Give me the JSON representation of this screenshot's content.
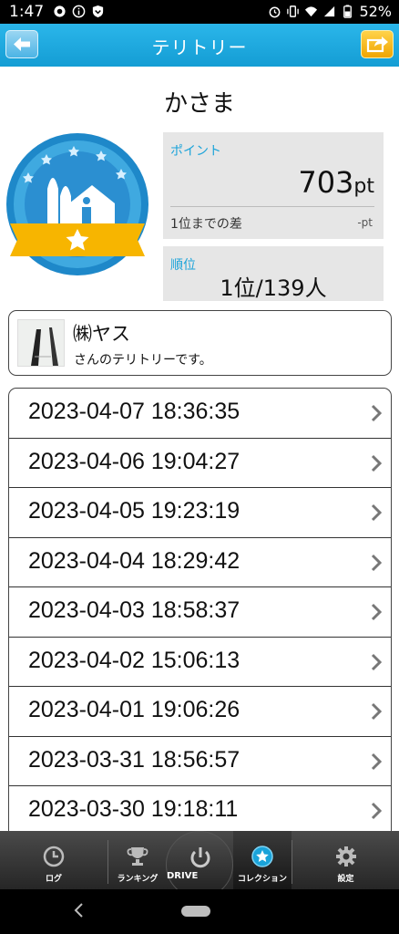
{
  "status_bar": {
    "time": "1:47",
    "battery": "52%"
  },
  "header": {
    "title": "テリトリー"
  },
  "territory": {
    "name": "かさま",
    "point_label": "ポイント",
    "point_value": "703",
    "point_unit": "pt",
    "diff_label": "1位までの差",
    "diff_value": "-pt",
    "rank_label": "順位",
    "rank_value": "1位/139人"
  },
  "owner": {
    "name": "㈱ヤス",
    "note": "さんのテリトリーです。"
  },
  "visits": [
    "2023-04-07 18:36:35",
    "2023-04-06 19:04:27",
    "2023-04-05 19:23:19",
    "2023-04-04 18:29:42",
    "2023-04-03 18:58:37",
    "2023-04-02 15:06:13",
    "2023-04-01 19:06:26",
    "2023-03-31 18:56:57",
    "2023-03-30 19:18:11"
  ],
  "tabs": [
    {
      "label": "ログ",
      "icon": "clock-icon"
    },
    {
      "label": "ランキング",
      "icon": "trophy-icon"
    },
    {
      "label": "DRIVE",
      "icon": "power-icon"
    },
    {
      "label": "コレクション",
      "icon": "star-icon"
    },
    {
      "label": "設定",
      "icon": "gear-icon"
    }
  ],
  "colors": {
    "accent": "#1aa3d9",
    "header": "#149dd4",
    "share": "#f0a500"
  }
}
